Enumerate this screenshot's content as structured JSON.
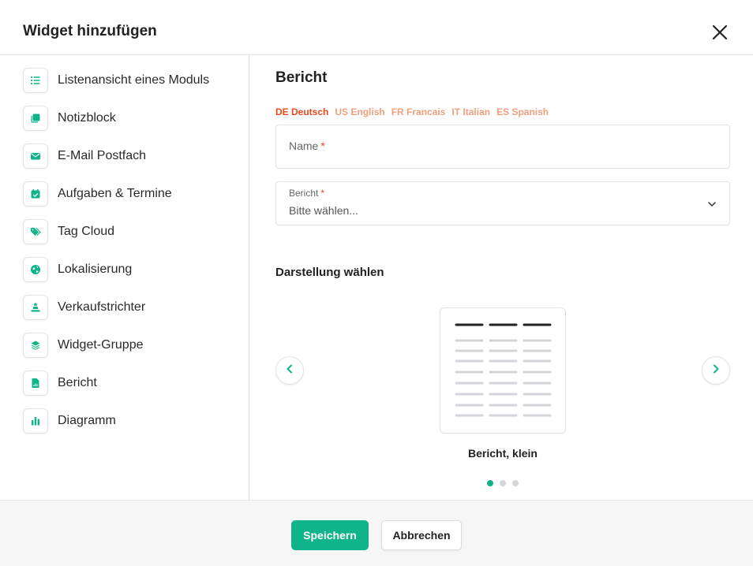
{
  "header": {
    "title": "Widget hinzufügen",
    "close_icon": "close-icon"
  },
  "sidebar": {
    "items": [
      {
        "label": "Listenansicht eines Moduls",
        "icon": "list-icon"
      },
      {
        "label": "Notizblock",
        "icon": "notepad-icon"
      },
      {
        "label": "E-Mail Postfach",
        "icon": "envelope-icon"
      },
      {
        "label": "Aufgaben & Termine",
        "icon": "calendar-check-icon"
      },
      {
        "label": "Tag Cloud",
        "icon": "tags-icon"
      },
      {
        "label": "Lokalisierung",
        "icon": "globe-icon"
      },
      {
        "label": "Verkaufstrichter",
        "icon": "funnel-icon"
      },
      {
        "label": "Widget-Gruppe",
        "icon": "layers-icon"
      },
      {
        "label": "Bericht",
        "icon": "report-file-icon"
      },
      {
        "label": "Diagramm",
        "icon": "bar-chart-icon"
      }
    ]
  },
  "main": {
    "title": "Bericht",
    "languages": [
      {
        "code": "DE",
        "label": "DE Deutsch",
        "active": true
      },
      {
        "code": "US",
        "label": "US English",
        "active": false
      },
      {
        "code": "FR",
        "label": "FR Francais",
        "active": false
      },
      {
        "code": "IT",
        "label": "IT Italian",
        "active": false
      },
      {
        "code": "ES",
        "label": "ES Spanish",
        "active": false
      }
    ],
    "name_field": {
      "placeholder": "Name",
      "required_mark": "*"
    },
    "report_field": {
      "label": "Bericht",
      "required_mark": "*",
      "value": "Bitte wählen..."
    },
    "display_section": {
      "title": "Darstellung wählen",
      "current_option": "Bericht, klein",
      "current_index": 0,
      "total_options": 3
    }
  },
  "footer": {
    "save_label": "Speichern",
    "cancel_label": "Abbrechen"
  },
  "colors": {
    "accent": "#10b48a",
    "language_active": "#e8481c",
    "language_inactive": "#f0a07f",
    "required": "#e8481c"
  }
}
